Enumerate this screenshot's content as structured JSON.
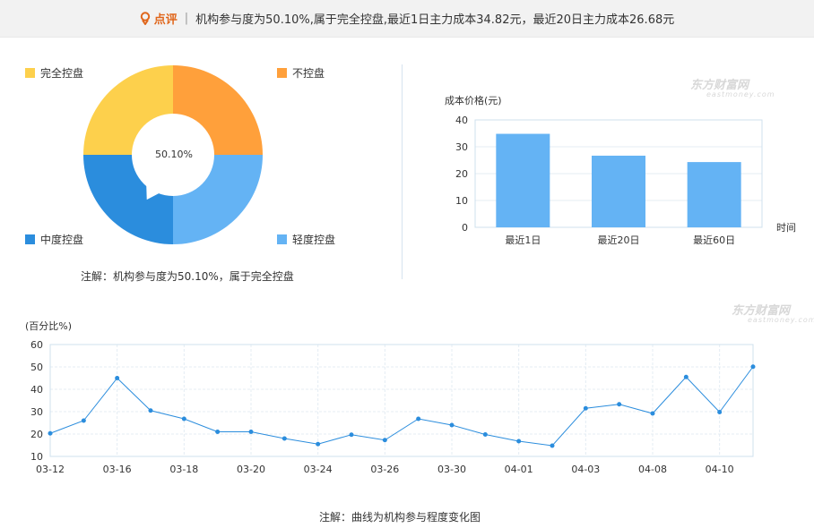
{
  "header": {
    "tag_label": "点评",
    "separator": "|",
    "summary": "机构参与度为50.10%,属于完全控盘,最近1日主力成本34.82元，最近20日主力成本26.68元"
  },
  "donut": {
    "center_label": "50.10%",
    "note": "注解：机构参与度为50.10%，属于完全控盘",
    "legend": [
      {
        "label": "完全控盘",
        "color": "#fdd04c"
      },
      {
        "label": "不控盘",
        "color": "#ffa03b"
      },
      {
        "label": "中度控盘",
        "color": "#2b8ddd"
      },
      {
        "label": "轻度控盘",
        "color": "#64b3f4"
      }
    ]
  },
  "watermark": {
    "name": "东方财富网",
    "domain": "eastmoney.com"
  },
  "chart_data": [
    {
      "type": "pie",
      "variant": "donut",
      "center_label": "50.10%",
      "slices": [
        {
          "label": "不控盘",
          "value": 25,
          "color": "#ffa03b"
        },
        {
          "label": "轻度控盘",
          "value": 25,
          "color": "#64b3f4"
        },
        {
          "label": "中度控盘",
          "value": 25,
          "color": "#2b8ddd"
        },
        {
          "label": "完全控盘",
          "value": 25,
          "color": "#fdd04c"
        }
      ],
      "pointer_value": 50.1
    },
    {
      "type": "bar",
      "categories": [
        "最近1日",
        "最近20日",
        "最近60日"
      ],
      "values": [
        34.82,
        26.68,
        24.3
      ],
      "ylabel": "成本价格(元)",
      "xlabel": "时间",
      "ylim": [
        0,
        40
      ],
      "yticks": [
        0,
        10,
        20,
        30,
        40
      ],
      "grid": true,
      "color": "#64b3f4"
    },
    {
      "type": "line",
      "ylabel": "(百分比%)",
      "ylim": [
        10,
        60
      ],
      "yticks": [
        10,
        20,
        30,
        40,
        50,
        60
      ],
      "grid": true,
      "x_tick_labels": [
        "03-12",
        "03-16",
        "03-18",
        "03-20",
        "03-24",
        "03-26",
        "03-30",
        "04-01",
        "04-03",
        "04-08",
        "04-10"
      ],
      "x_tick_positions": [
        0,
        2,
        4,
        6,
        8,
        10,
        12,
        14,
        16,
        18,
        20
      ],
      "values": [
        20.3,
        26.0,
        45.0,
        30.5,
        26.8,
        21.0,
        21.0,
        18.0,
        15.5,
        19.7,
        17.3,
        26.8,
        24.0,
        19.8,
        16.8,
        14.8,
        31.5,
        33.3,
        29.2,
        45.5,
        29.8,
        50.1
      ],
      "note": "注解：曲线为机构参与程度变化图",
      "color": "#2b8ddd"
    }
  ]
}
